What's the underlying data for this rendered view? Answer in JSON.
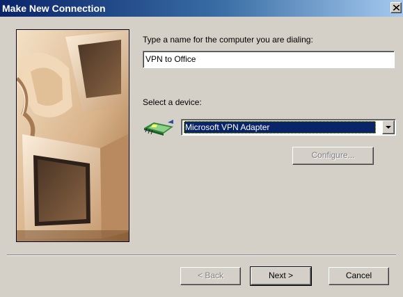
{
  "window": {
    "title": "Make New Connection",
    "close_icon": "close-icon"
  },
  "form": {
    "name_prompt": "Type a name for the computer you are dialing:",
    "name_value": "VPN to Office",
    "device_prompt": "Select a device:",
    "device_icon": "network-adapter-icon",
    "device_selected": "Microsoft VPN Adapter",
    "configure_label": "Configure..."
  },
  "footer": {
    "back_label": "< Back",
    "next_label": "Next >",
    "cancel_label": "Cancel"
  },
  "colors": {
    "title_bar": "#0a246a",
    "dialog_bg": "#d4d0c8",
    "selection": "#0a246a"
  }
}
